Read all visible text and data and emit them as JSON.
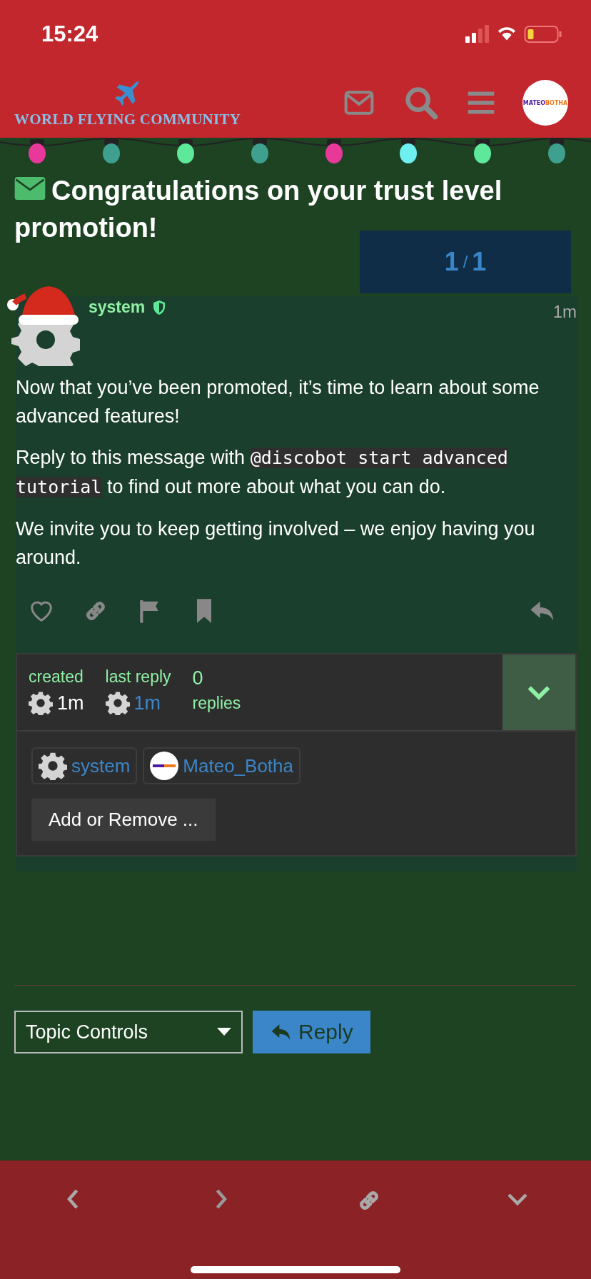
{
  "status_bar": {
    "time": "15:24"
  },
  "header": {
    "logo_text": "WORLD FLYING COMMUNITY",
    "avatar_parts": [
      {
        "text": "MATEO",
        "color": "#4b1aa0"
      },
      {
        "text": "BOTHA",
        "color": "#f07a1a"
      }
    ]
  },
  "topic": {
    "title": "Congratulations on your trust level promotion!",
    "progress": {
      "current": "1",
      "separator": "/",
      "total": "1"
    }
  },
  "post": {
    "username": "system",
    "time": "1m",
    "paragraphs": [
      [
        {
          "kind": "text",
          "text": "Now that you’ve been promoted, it’s time to learn about some advanced features!"
        }
      ],
      [
        {
          "kind": "text",
          "text": "Reply to this message with "
        },
        {
          "kind": "code",
          "text": "@discobot start advanced tutorial"
        },
        {
          "kind": "text",
          "text": " to find out more about what you can do."
        }
      ],
      [
        {
          "kind": "text",
          "text": "We invite you to keep getting involved – we enjoy having you around."
        }
      ]
    ]
  },
  "topic_map": {
    "created_label": "created",
    "created_time": "1m",
    "last_reply_label": "last reply",
    "last_reply_time": "1m",
    "replies_count": "0",
    "replies_label": "replies",
    "expanded": false,
    "participants": [
      {
        "kind": "gear",
        "name": "system"
      },
      {
        "kind": "logo",
        "name": "Mateo_Botha"
      }
    ],
    "add_remove": "Add or Remove ..."
  },
  "footer": {
    "topic_controls": "Topic Controls",
    "reply": "Reply"
  }
}
